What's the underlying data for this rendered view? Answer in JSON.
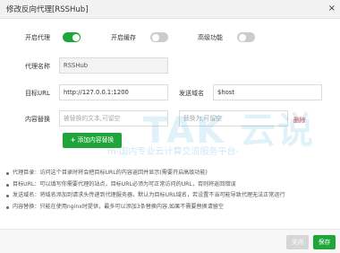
{
  "dialog": {
    "title": "修改反向代理[RSSHub]",
    "close_glyph": "×"
  },
  "toggles": {
    "enable_proxy": {
      "label": "开启代理",
      "on": true
    },
    "enable_cache": {
      "label": "开启缓存",
      "on": false
    },
    "advanced": {
      "label": "高级功能",
      "on": false
    }
  },
  "form": {
    "proxy_name": {
      "label": "代理名称",
      "value": "RSSHub"
    },
    "target_url": {
      "label": "目标URL",
      "value": "http://127.0.0.1:1200"
    },
    "send_domain": {
      "label": "发送域名",
      "value": "$host"
    },
    "content_replace": {
      "label": "内容替换",
      "source_placeholder": "被替换的文本,可留空",
      "target_placeholder": "替换为,可留空",
      "delete_label": "删除"
    },
    "add_button": {
      "plus": "+",
      "label": "添加内容替换"
    }
  },
  "notes": [
    "代理目录：访问这个目录时将会把目标URL的内容返回并显示(需要开启高级功能)",
    "目标URL：可以填写你需要代理的站点，目标URL必须为可正常访问的URL，否则将返回错误",
    "发送域名：将域名添加到请求头传递到代理服务器，默认为目标URL域名，若设置不当可能导致代理无法正常运行",
    "内容替换：只能在使用nginx时提供，最多可以添加3条替换内容,如果不需要替换请留空"
  ],
  "footer": {
    "close_label": "关闭",
    "save_label": "保存"
  },
  "watermark": {
    "main": "TAK 云说",
    "sub": "m-国内专业云计算交流服务平台-"
  },
  "colors": {
    "accent": "#20a53a",
    "danger": "#e2463b",
    "watermark": "#1596d6"
  }
}
